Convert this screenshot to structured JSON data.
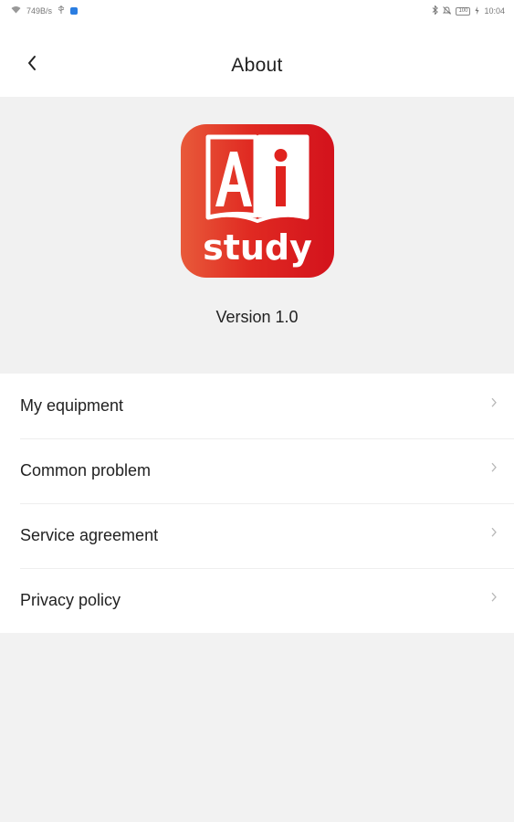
{
  "status_bar": {
    "net_speed": "749B/s",
    "time": "10:04",
    "battery": "100"
  },
  "header": {
    "title": "About"
  },
  "app": {
    "logo_text_top": "Ai",
    "logo_text_bottom": "study",
    "version": "Version 1.0",
    "brand_color": "#e0231e"
  },
  "menu": {
    "items": [
      {
        "label": "My equipment"
      },
      {
        "label": "Common problem"
      },
      {
        "label": "Service agreement"
      },
      {
        "label": "Privacy policy"
      }
    ]
  },
  "icons": {
    "back": "chevron-left-icon",
    "item_arrow": "chevron-right-icon"
  }
}
